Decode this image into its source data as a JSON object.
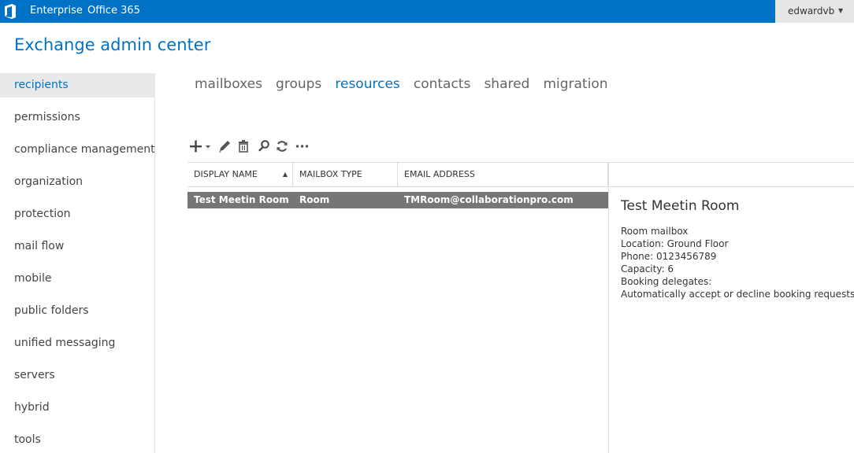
{
  "topbar": {
    "logo_icon": "office-logo-icon",
    "links": [
      "Enterprise",
      "Office 365"
    ],
    "user": "edwardvb",
    "accent_color": "#0072c6"
  },
  "app_title": "Exchange admin center",
  "nav": {
    "items": [
      "recipients",
      "permissions",
      "compliance management",
      "organization",
      "protection",
      "mail flow",
      "mobile",
      "public folders",
      "unified messaging",
      "servers",
      "hybrid",
      "tools"
    ],
    "active": "recipients"
  },
  "tabs": {
    "items": [
      "mailboxes",
      "groups",
      "resources",
      "contacts",
      "shared",
      "migration"
    ],
    "active": "resources"
  },
  "toolbar": {
    "icons": [
      "add-icon",
      "edit-icon",
      "delete-icon",
      "search-icon",
      "refresh-icon",
      "more-icon"
    ]
  },
  "table": {
    "columns": [
      "DISPLAY NAME",
      "MAILBOX TYPE",
      "EMAIL ADDRESS"
    ],
    "sort_column": "DISPLAY NAME",
    "sort_direction": "ascending",
    "rows": [
      {
        "display_name": "Test Meetin Room",
        "mailbox_type": "Room",
        "email": "TMRoom@collaborationpro.com",
        "selected": true
      }
    ]
  },
  "details": {
    "title": "Test Meetin Room",
    "lines": [
      "Room mailbox",
      "Location: Ground Floor",
      "Phone: 0123456789",
      "Capacity: 6",
      "Booking delegates:",
      "Automatically accept or decline booking requests"
    ]
  }
}
